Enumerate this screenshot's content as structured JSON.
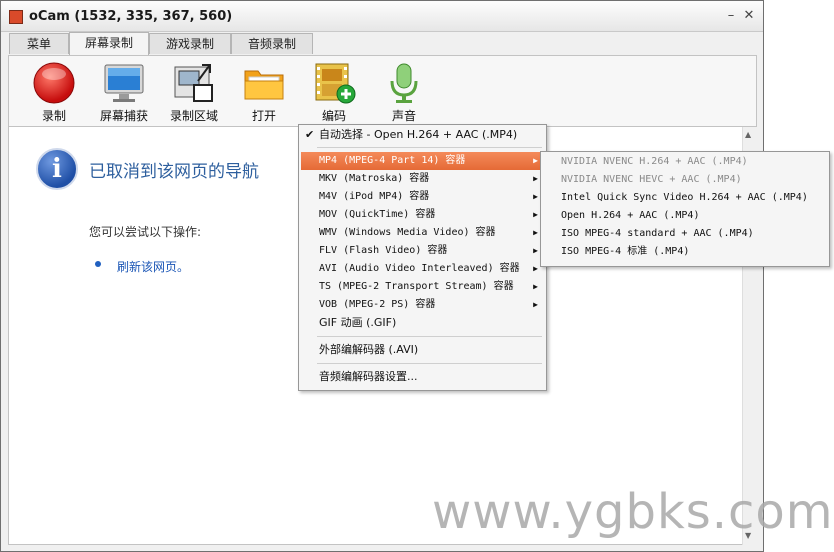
{
  "window": {
    "title": "oCam (1532, 335, 367, 560)",
    "minimize": "–",
    "close": "✕"
  },
  "tabs": [
    "菜单",
    "屏幕录制",
    "游戏录制",
    "音频录制"
  ],
  "toolbar": {
    "record": "录制",
    "capture": "屏幕捕获",
    "region": "录制区域",
    "open": "打开",
    "codec": "编码",
    "sound": "声音"
  },
  "page": {
    "info_glyph": "i",
    "title": "已取消到该网页的导航",
    "try_text": "您可以尝试以下操作:",
    "refresh_link": "刷新该网页。"
  },
  "codec_menu": {
    "auto": "自动选择 - Open H.264 + AAC (.MP4)",
    "items": [
      "MP4 (MPEG-4 Part 14) 容器",
      "MKV (Matroska) 容器",
      "M4V (iPod MP4) 容器",
      "MOV (QuickTime) 容器",
      "WMV (Windows Media Video) 容器",
      "FLV (Flash Video) 容器",
      "AVI (Audio Video Interleaved) 容器",
      "TS (MPEG-2 Transport Stream) 容器",
      "VOB (MPEG-2 PS) 容器",
      "GIF 动画 (.GIF)"
    ],
    "external": "外部编解码器 (.AVI)",
    "audio_settings": "音频编解码器设置..."
  },
  "mp4_submenu": [
    "NVIDIA NVENC H.264 + AAC (.MP4)",
    "NVIDIA NVENC HEVC + AAC (.MP4)",
    "Intel Quick Sync Video H.264 + AAC (.MP4)",
    "Open H.264 + AAC (.MP4)",
    "ISO MPEG-4 standard + AAC (.MP4)",
    "ISO MPEG-4 标准 (.MP4)"
  ],
  "watermark": "www.ygbks.com",
  "colors": {
    "highlight": "#e56a36",
    "link": "#1a55b5",
    "title_blue": "#2e5f9e"
  }
}
